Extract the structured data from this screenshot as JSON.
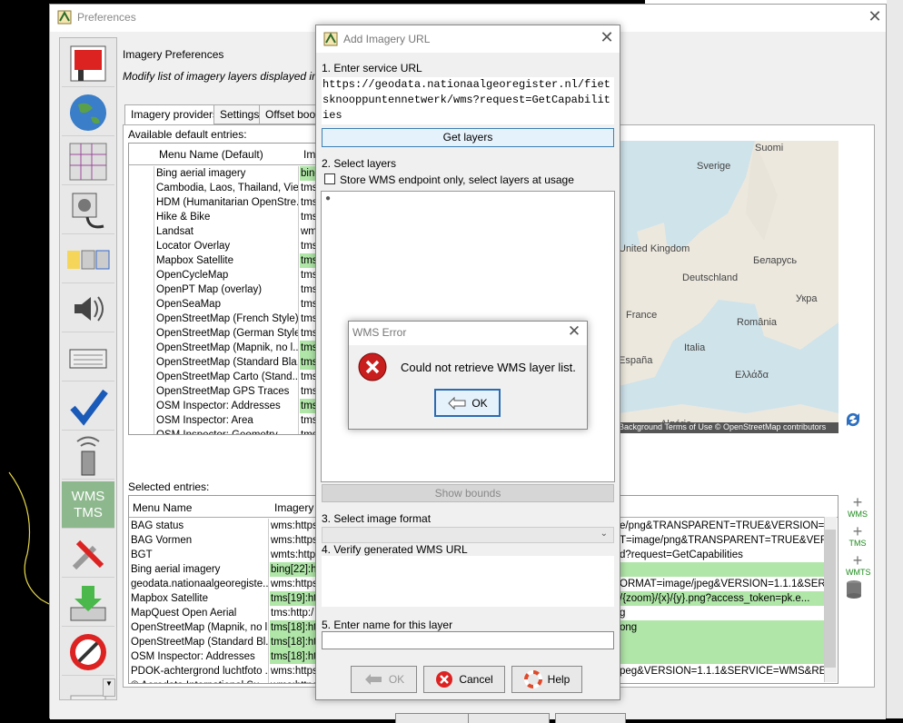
{
  "preferences": {
    "title": "Preferences",
    "panel_title": "Imagery Preferences",
    "panel_desc": "Modify list of imagery layers displayed in the Imagery menu",
    "tabs": [
      "Imagery providers",
      "Settings",
      "Offset bookmarks"
    ],
    "available_label": "Available default entries:",
    "available_columns": [
      "Menu Name (Default)",
      "Imagery URL (Default)"
    ],
    "available_rows": [
      {
        "name": "Bing aerial imagery",
        "url": "bing",
        "green": true
      },
      {
        "name": "Cambodia, Laos, Thailand, Vie...",
        "url": "tms",
        "green": false
      },
      {
        "name": "HDM (Humanitarian OpenStre...",
        "url": "tms",
        "green": false
      },
      {
        "name": "Hike & Bike",
        "url": "tms",
        "green": false
      },
      {
        "name": "Landsat",
        "url": "wms",
        "green": false
      },
      {
        "name": "Locator Overlay",
        "url": "tms",
        "green": false
      },
      {
        "name": "Mapbox Satellite",
        "url": "tms",
        "green": true
      },
      {
        "name": "OpenCycleMap",
        "url": "tms",
        "green": false
      },
      {
        "name": "OpenPT Map (overlay)",
        "url": "tms",
        "green": false
      },
      {
        "name": "OpenSeaMap",
        "url": "tms",
        "green": false
      },
      {
        "name": "OpenStreetMap (French Style)",
        "url": "tms",
        "green": false
      },
      {
        "name": "OpenStreetMap (German Style)",
        "url": "tms",
        "green": false
      },
      {
        "name": "OpenStreetMap (Mapnik, no l...",
        "url": "tms",
        "green": true
      },
      {
        "name": "OpenStreetMap (Standard Bla...",
        "url": "tms",
        "green": true
      },
      {
        "name": "OpenStreetMap Carto (Stand...",
        "url": "tms",
        "green": false
      },
      {
        "name": "OpenStreetMap GPS Traces",
        "url": "tms",
        "green": false
      },
      {
        "name": "OSM Inspector: Addresses",
        "url": "tms",
        "green": true
      },
      {
        "name": "OSM Inspector: Area",
        "url": "tms",
        "green": false
      },
      {
        "name": "OSM Inspector: Geometry",
        "url": "tms",
        "green": false
      }
    ],
    "map_labels": [
      "Suomi",
      "Sverige",
      "United Kingdom",
      "Deutschland",
      "Беларусь",
      "Укра",
      "France",
      "România",
      "Italia",
      "España",
      "Ελλάδα",
      "Algérie"
    ],
    "map_attribution": "Background Terms of Use © OpenStreetMap contributors",
    "selected_label": "Selected entries:",
    "selected_columns": [
      "Menu Name",
      "Imagery URL"
    ],
    "selected_rows": [
      {
        "name": "BAG status",
        "url": "wms:https",
        "tail": "e/png&TRANSPARENT=TRUE&VERSION=1...",
        "green": false
      },
      {
        "name": "BAG Vormen",
        "url": "wms:https",
        "tail": "T=image/png&TRANSPARENT=TRUE&VER...",
        "green": false
      },
      {
        "name": "BGT",
        "url": "wmts:http",
        "tail": "d?request=GetCapabilities",
        "green": false
      },
      {
        "name": "Bing aerial imagery",
        "url": "bing[22]:h",
        "tail": "",
        "green": true
      },
      {
        "name": "geodata.nationaalgeoregiste...",
        "url": "wms:https",
        "tail": "ORMAT=image/jpeg&VERSION=1.1.1&SER...",
        "green": false
      },
      {
        "name": "Mapbox Satellite",
        "url": "tms[19]:ht",
        "tail": "/{zoom}/{x}/{y}.png?access_token=pk.e...",
        "green": true
      },
      {
        "name": "MapQuest Open Aerial",
        "url": "tms:http:/",
        "tail": "g",
        "green": false
      },
      {
        "name": "OpenStreetMap (Mapnik, no l...",
        "url": "tms[18]:ht",
        "tail": "ong",
        "green": true
      },
      {
        "name": "OpenStreetMap (Standard Bl...",
        "url": "tms[18]:ht",
        "tail": "",
        "green": true
      },
      {
        "name": "OSM Inspector: Addresses",
        "url": "tms[18]:ht",
        "tail": "",
        "green": true
      },
      {
        "name": "PDOK-achtergrond luchtfoto ...",
        "url": "wms:https",
        "tail": "peg&VERSION=1.1.1&SERVICE=WMS&RE...",
        "green": false
      },
      {
        "name": "© Aerodata International Su...",
        "url": "wms:https",
        "tail": "",
        "green": false
      }
    ],
    "side_buttons": [
      "WMS",
      "TMS",
      "WMTS"
    ],
    "left_tab_icons": [
      "display-settings-icon",
      "globe-icon",
      "map-grid-icon",
      "connection-icon",
      "toolbar-icon",
      "audio-icon",
      "keyboard-icon",
      "validator-check-icon",
      "remote-control-icon",
      "imagery-wms-tms-icon",
      "advanced-tools-icon",
      "download-plugins-icon",
      "no-entry-icon",
      "more-icon"
    ],
    "left_tab_wms_label": "WMS TMS"
  },
  "add_url_dialog": {
    "title": "Add Imagery URL",
    "step1": "1. Enter service URL",
    "service_url": "https://geodata.nationaalgeoregister.nl/fietsknooppuntennetwerk/wms?request=GetCapabilities",
    "get_layers": "Get layers",
    "step2": "2. Select layers",
    "store_checkbox": "Store WMS endpoint only, select layers at usage",
    "show_bounds": "Show bounds",
    "step3": "3. Select image format",
    "step4": "4. Verify generated WMS URL",
    "step5": "5. Enter name for this layer",
    "ok": "OK",
    "cancel": "Cancel",
    "help": "Help"
  },
  "wms_error": {
    "title": "WMS Error",
    "message": "Could not retrieve WMS layer list.",
    "ok": "OK"
  }
}
